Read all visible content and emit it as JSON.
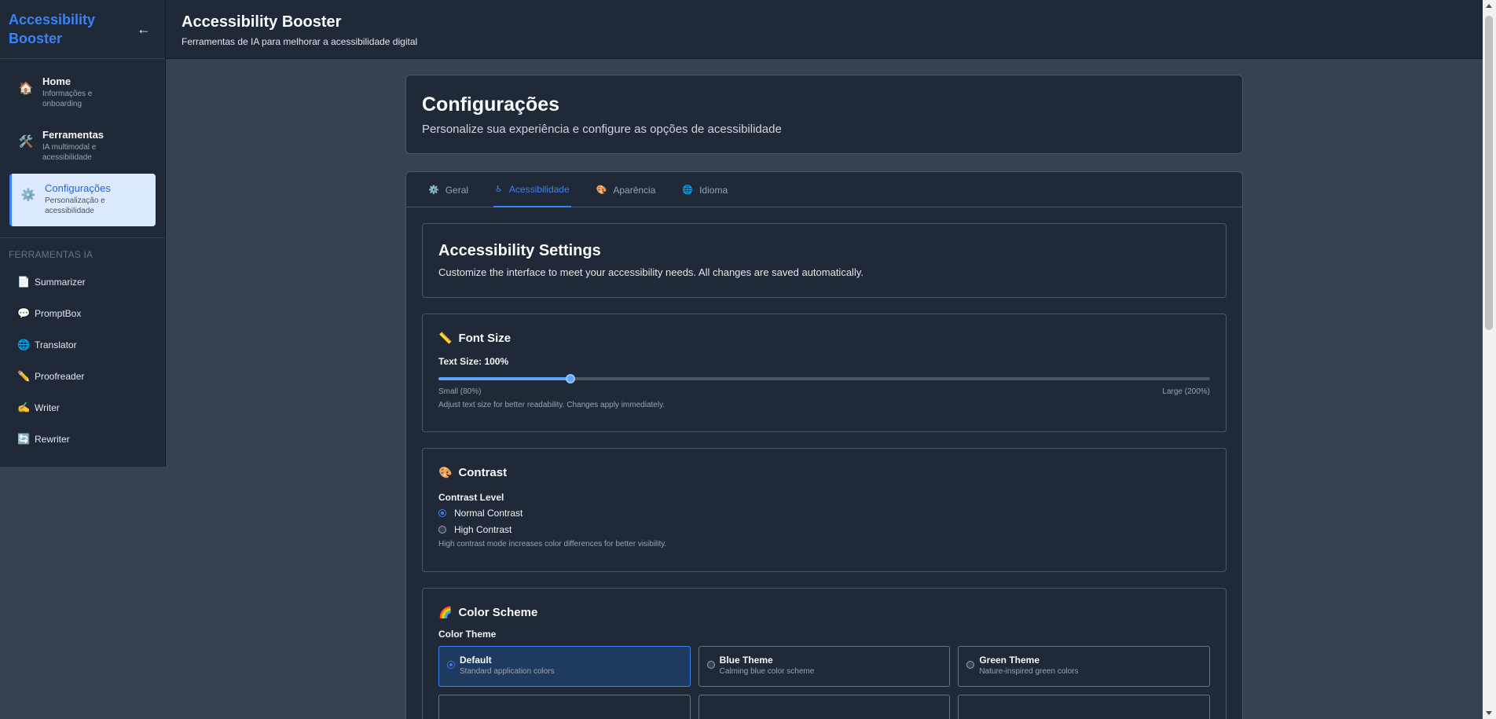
{
  "sidebar": {
    "brand": "Accessibility Booster",
    "collapse_icon": "←",
    "nav": [
      {
        "icon": "🏠",
        "title": "Home",
        "sub": "Informações e onboarding"
      },
      {
        "icon": "🛠️",
        "title": "Ferramentas",
        "sub": "IA multimodal e acessibilidade"
      },
      {
        "icon": "⚙️",
        "title": "Configurações",
        "sub": "Personalização e acessibilidade"
      }
    ],
    "section_label": "FERRAMENTAS IA",
    "tools": [
      {
        "icon": "📄",
        "label": "Summarizer"
      },
      {
        "icon": "💬",
        "label": "PromptBox"
      },
      {
        "icon": "🌐",
        "label": "Translator"
      },
      {
        "icon": "✏️",
        "label": "Proofreader"
      },
      {
        "icon": "✍️",
        "label": "Writer"
      },
      {
        "icon": "🔄",
        "label": "Rewriter"
      }
    ]
  },
  "header": {
    "title": "Accessibility Booster",
    "subtitle": "Ferramentas de IA para melhorar a acessibilidade digital"
  },
  "page": {
    "title": "Configurações",
    "subtitle": "Personalize sua experiência e configure as opções de acessibilidade"
  },
  "tabs": [
    {
      "icon": "⚙️",
      "label": "Geral"
    },
    {
      "icon": "♿",
      "label": "Acessibilidade"
    },
    {
      "icon": "🎨",
      "label": "Aparência"
    },
    {
      "icon": "🌐",
      "label": "Idioma"
    }
  ],
  "accessibility": {
    "title": "Accessibility Settings",
    "description": "Customize the interface to meet your accessibility needs. All changes are saved automatically."
  },
  "font_size": {
    "icon": "📏",
    "title": "Font Size",
    "label": "Text Size: 100%",
    "value_fraction": 0.171,
    "min_label": "Small (80%)",
    "max_label": "Large (200%)",
    "hint": "Adjust text size for better readability. Changes apply immediately."
  },
  "contrast": {
    "icon": "🎨",
    "title": "Contrast",
    "label": "Contrast Level",
    "options": [
      "Normal Contrast",
      "High Contrast"
    ],
    "hint": "High contrast mode increases color differences for better visibility."
  },
  "color_scheme": {
    "icon": "🌈",
    "title": "Color Scheme",
    "label": "Color Theme",
    "themes": [
      {
        "title": "Default",
        "sub": "Standard application colors"
      },
      {
        "title": "Blue Theme",
        "sub": "Calming blue color scheme"
      },
      {
        "title": "Green Theme",
        "sub": "Nature-inspired green colors"
      }
    ]
  }
}
